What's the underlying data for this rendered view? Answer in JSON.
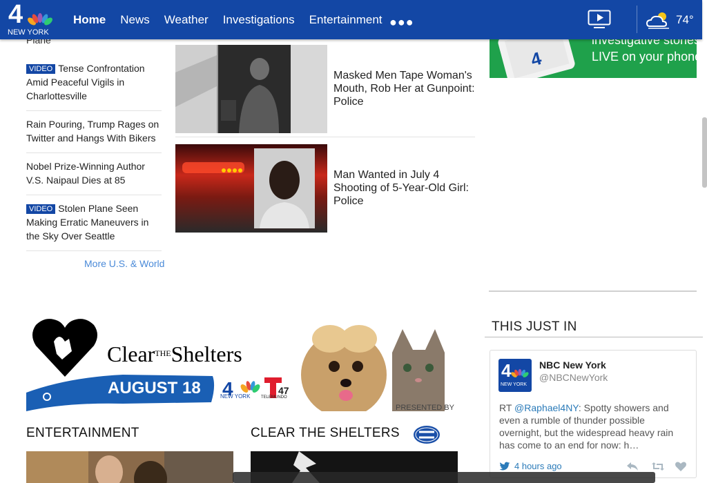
{
  "header": {
    "logo_number": "4",
    "logo_sub": "NEW YORK",
    "nav": [
      "Home",
      "News",
      "Weather",
      "Investigations",
      "Entertainment"
    ],
    "temperature": "74°"
  },
  "left_list": {
    "stub": "Plane",
    "items": [
      {
        "badge": "VIDEO",
        "title": "Tense Confrontation Amid Peaceful Vigils in Charlottesville"
      },
      {
        "badge": "",
        "title": "Rain Pouring, Trump Rages on Twitter and Hangs With Bikers"
      },
      {
        "badge": "",
        "title": "Nobel Prize-Winning Author V.S. Naipaul Dies at 85"
      },
      {
        "badge": "VIDEO",
        "title": "Stolen Plane Seen Making Erratic Maneuvers in the Sky Over Seattle"
      }
    ],
    "more": "More U.S. & World"
  },
  "stories": [
    {
      "title": "Masked Men Tape Woman's Mouth, Rob Her at Gunpoint: Police"
    },
    {
      "title": "Man Wanted in July 4 Shooting of 5-Year-Old Girl: Police"
    }
  ],
  "promo": {
    "line1": "investigative stories",
    "line2": "LIVE on your phone."
  },
  "banner": {
    "title_part1": "Clear",
    "title_the": "THE",
    "title_part2": "Shelters",
    "date": "AUGUST 18",
    "presented": "PRESENTED BY",
    "tele": "TELEMUNDO",
    "tele_num": "47",
    "nbc_sub": "NEW YORK"
  },
  "sections": {
    "entertainment": "ENTERTAINMENT",
    "clear": "CLEAR THE SHELTERS"
  },
  "sidebar": {
    "just_in": "THIS JUST IN",
    "tweet": {
      "name": "NBC New York",
      "handle": "@NBCNewYork",
      "prefix": "RT ",
      "mention": "@Raphael4NY",
      "text": ": Spotty showers and even a rumble of thunder possible overnight, but the widespread heavy rain has come to an end for now: h…",
      "time": "4 hours ago"
    }
  },
  "colors": {
    "brand": "#1347a5",
    "link": "#4a8ad8",
    "promo": "#1fa14b",
    "twitter": "#2b7bb9"
  }
}
